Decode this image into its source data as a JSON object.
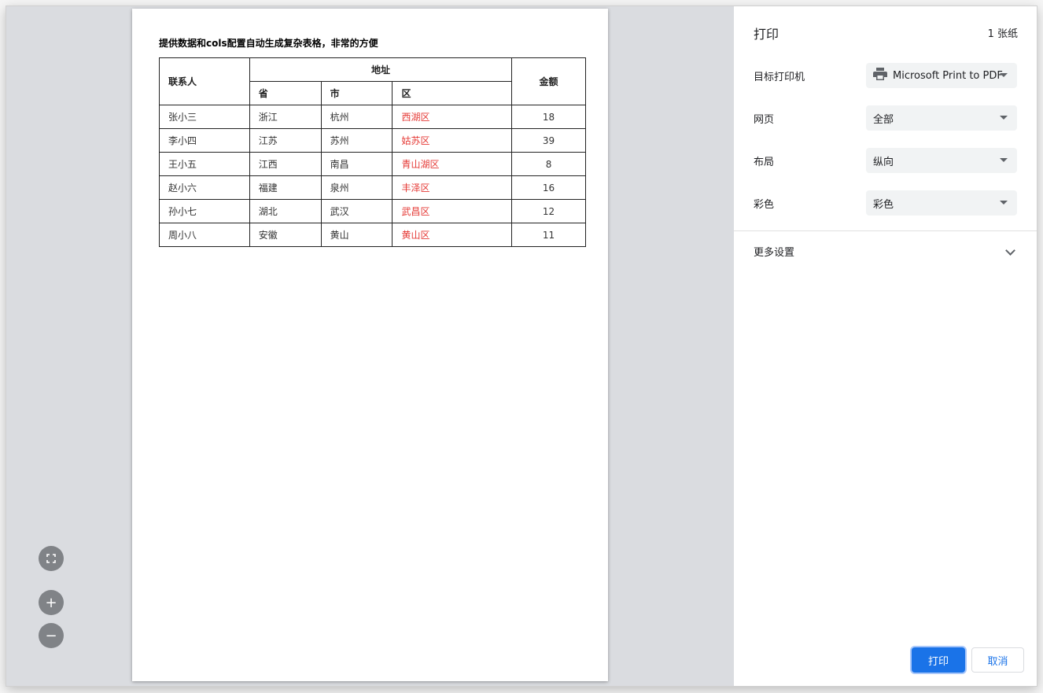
{
  "preview": {
    "doc_title": "提供数据和cols配置自动生成复杂表格，非常的方便",
    "table": {
      "header_top": {
        "contact": "联系人",
        "address": "地址",
        "amount": "金额"
      },
      "header_sub": {
        "province": "省",
        "city": "市",
        "district": "区"
      },
      "rows": [
        {
          "contact": "张小三",
          "province": "浙江",
          "city": "杭州",
          "district": "西湖区",
          "amount": "18"
        },
        {
          "contact": "李小四",
          "province": "江苏",
          "city": "苏州",
          "district": "姑苏区",
          "amount": "39"
        },
        {
          "contact": "王小五",
          "province": "江西",
          "city": "南昌",
          "district": "青山湖区",
          "amount": "8"
        },
        {
          "contact": "赵小六",
          "province": "福建",
          "city": "泉州",
          "district": "丰泽区",
          "amount": "16"
        },
        {
          "contact": "孙小七",
          "province": "湖北",
          "city": "武汉",
          "district": "武昌区",
          "amount": "12"
        },
        {
          "contact": "周小八",
          "province": "安徽",
          "city": "黄山",
          "district": "黄山区",
          "amount": "11"
        }
      ]
    },
    "zoom_controls": {
      "fit_icon": "fit-to-page-icon",
      "zoom_in": "+",
      "zoom_out": "−"
    }
  },
  "settings": {
    "title": "打印",
    "sheet_count": "1 张纸",
    "destination": {
      "label": "目标打印机",
      "value": "Microsoft Print to PDF",
      "icon": "printer-icon"
    },
    "pages": {
      "label": "网页",
      "value": "全部"
    },
    "layout": {
      "label": "布局",
      "value": "纵向"
    },
    "color": {
      "label": "彩色",
      "value": "彩色"
    },
    "more_settings": "更多设置",
    "print_button": "打印",
    "cancel_button": "取消"
  },
  "colors": {
    "accent": "#1a73e8",
    "highlight_text": "#e53935",
    "preview_bg": "#dadce0"
  }
}
